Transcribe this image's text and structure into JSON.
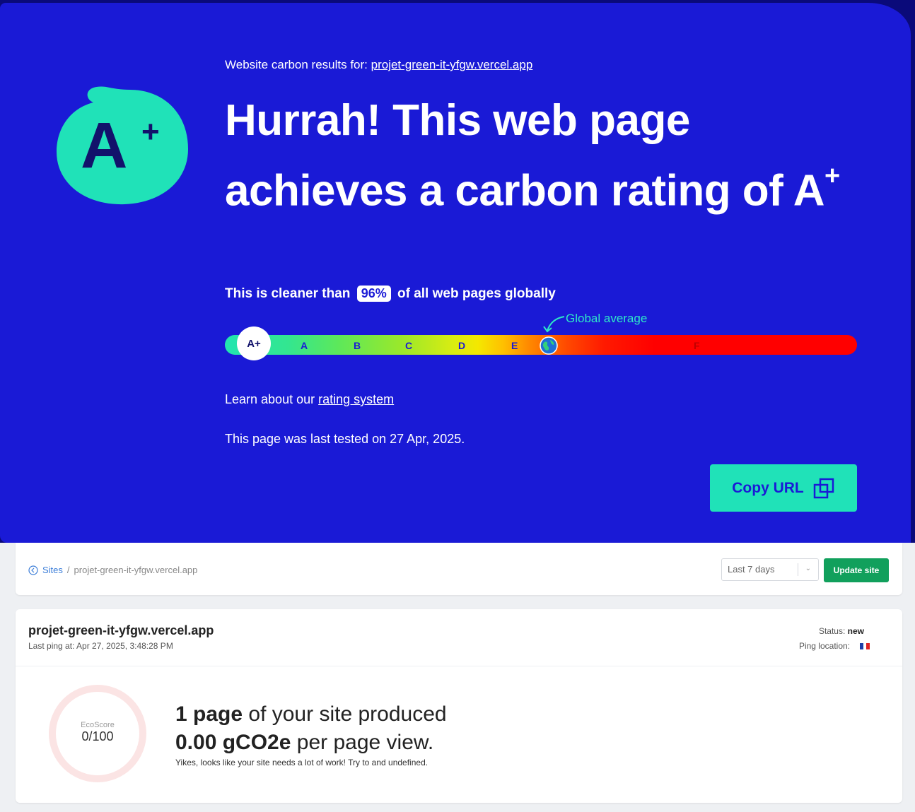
{
  "hero": {
    "results_for_label": "Website carbon results for:",
    "results_for_url": "projet-green-it-yfgw.vercel.app",
    "badge": {
      "grade": "A",
      "plus": "+"
    },
    "headline_text": "Hurrah! This web page achieves a carbon rating of A",
    "headline_sup": "+",
    "cleaner_prefix": "This is cleaner than",
    "cleaner_percent": "96%",
    "cleaner_suffix": "of all web pages globally",
    "global_average_label": "Global average",
    "scale": {
      "current_grade": "A+",
      "grades": [
        "A",
        "B",
        "C",
        "D",
        "E",
        "F"
      ]
    },
    "learn_prefix": "Learn about our",
    "learn_link": "rating system",
    "tested_text": "This page was last tested on 27 Apr, 2025.",
    "copy_button_label": "Copy URL",
    "colors": {
      "background": "#1a1ad6",
      "accent": "#20e2b8"
    }
  },
  "dashboard": {
    "breadcrumb": {
      "root": "Sites",
      "separator": "/",
      "current": "projet-green-it-yfgw.vercel.app"
    },
    "period_select": {
      "selected": "Last 7 days"
    },
    "update_button_label": "Update site",
    "site": {
      "name": "projet-green-it-yfgw.vercel.app",
      "last_ping": "Last ping at: Apr 27, 2025, 3:48:28 PM",
      "status_label": "Status:",
      "status_value": "new",
      "ping_location_label": "Ping location:"
    },
    "ecoscore": {
      "label": "EcoScore",
      "value": "0/100"
    },
    "produced": {
      "count_bold": "1 page",
      "count_rest": "of your site produced",
      "amount_bold": "0.00 gCO2e",
      "amount_rest": "per page view."
    },
    "message": "Yikes, looks like your site needs a lot of work! Try to and undefined.",
    "colors": {
      "update_button": "#11a05c",
      "link": "#3b7dd8"
    }
  }
}
